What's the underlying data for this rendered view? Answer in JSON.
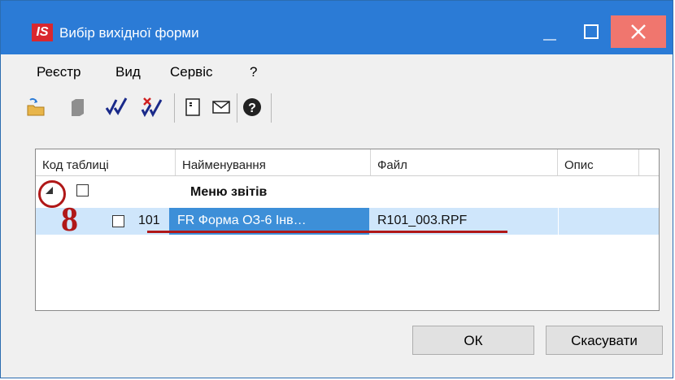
{
  "window": {
    "title": "Вибір вихідної форми",
    "app_logo": "IS",
    "controls": [
      "minimize-icon",
      "maximize-icon",
      "close-icon"
    ]
  },
  "menu": {
    "items": [
      "Реєстр",
      "Вид",
      "Сервіс",
      "?"
    ]
  },
  "toolbar": {
    "icons": [
      "open-folder-icon",
      "document-icon",
      "check-all-icon",
      "uncheck-all-icon",
      "form-icon",
      "envelope-icon",
      "help-icon"
    ]
  },
  "grid": {
    "columns": [
      "Код таблиці",
      "Найменування",
      "Файл",
      "Опис"
    ],
    "group": {
      "name": "Меню звітів",
      "checked": false
    },
    "rows": [
      {
        "code": "101",
        "name": "FR Форма ОЗ-6 Інв…",
        "file": "R101_003.RPF",
        "description": "",
        "checked": false
      }
    ]
  },
  "annotation": {
    "number": "8"
  },
  "buttons": {
    "ok": "ОК",
    "cancel": "Скасувати"
  },
  "colors": {
    "titlebar": "#2b7bd6",
    "close": "#f0766e",
    "selection": "#3d8fd8",
    "selection_row": "#cfe6fb",
    "annotation": "#b01818"
  }
}
